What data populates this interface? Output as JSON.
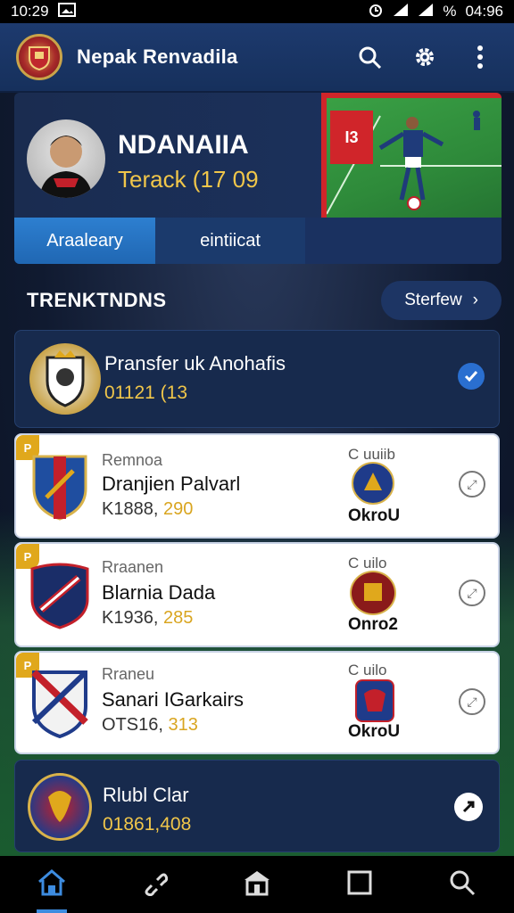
{
  "status": {
    "time": "10:29",
    "clock": "04:96",
    "battery_text": "%"
  },
  "app": {
    "title": "Nepak Renvadila",
    "accent": "#2d7fd0",
    "gold": "#f0c64a"
  },
  "hero": {
    "name": "NDANAIIA",
    "subtitle": "Terack (17 09",
    "photo_badge": "I3"
  },
  "tabs": [
    {
      "label": "Araaleary",
      "active": true
    },
    {
      "label": "eintiicat",
      "active": false
    }
  ],
  "section": {
    "title": "TRENKTNDNS",
    "showall_label": "Sterfew"
  },
  "featured": {
    "title": "Pransfer uk Anohafis",
    "value": "01121 (13"
  },
  "rows": [
    {
      "tag": "P",
      "sublabel": "Remnoa",
      "name": "Dranjien Palvarl",
      "value_prefix": "K1888,",
      "value": "290",
      "right_label": "C uuiib",
      "opponent": "OkroU"
    },
    {
      "tag": "P",
      "sublabel": "Rraanen",
      "name": "Blarnia Dada",
      "value_prefix": "K1936,",
      "value": "285",
      "right_label": "C uilo",
      "opponent": "Onro2"
    },
    {
      "tag": "P",
      "sublabel": "Rraneu",
      "name": "Sanari IGarkairs",
      "value_prefix": "OTS16,",
      "value": "313",
      "right_label": "C uilo",
      "opponent": "OkroU"
    }
  ],
  "bottom_card": {
    "title": "Rlubl Clar",
    "value": "01861,408"
  },
  "nav": [
    "home-icon",
    "link-icon",
    "shop-icon",
    "square-icon",
    "search-icon"
  ]
}
